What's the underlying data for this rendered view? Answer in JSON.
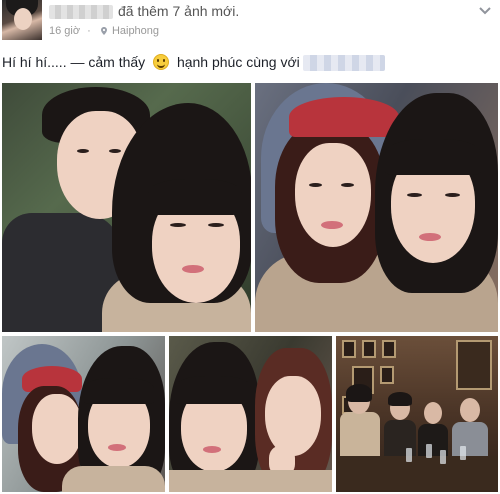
{
  "header": {
    "action_text": "đã thêm 7 ảnh mới.",
    "time": "16 giờ",
    "separator": "·",
    "location": "Haiphong"
  },
  "post": {
    "status_text": "Hí hí hí..... — cảm thấy",
    "feeling_text": "hạnh phúc cùng với"
  },
  "icons": {
    "emoji": "smiley-face-icon",
    "location": "location-pin-icon",
    "menu": "chevron-down-icon"
  },
  "colors": {
    "text_primary": "#1d2129",
    "text_secondary": "#999999"
  }
}
